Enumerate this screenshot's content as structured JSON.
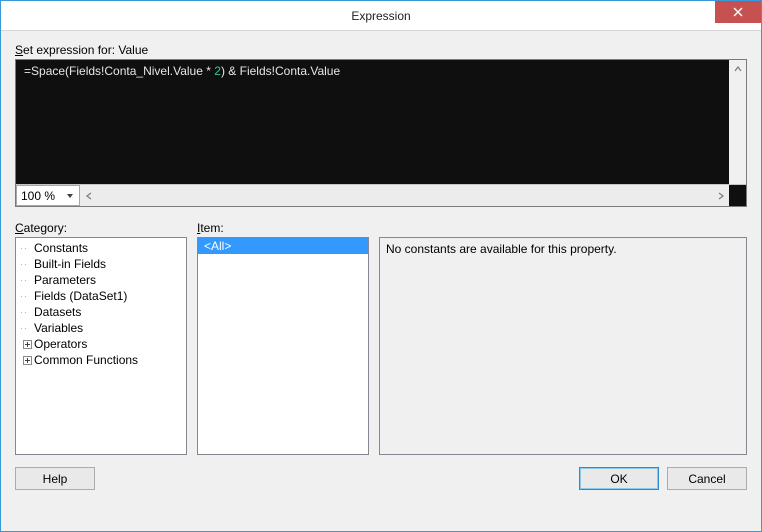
{
  "window": {
    "title": "Expression"
  },
  "labelExpressionPrefix": "S",
  "labelExpressionRest": "et expression for: Value",
  "code": {
    "t1": "=",
    "t2": "Space",
    "t3": "(Fields!Conta_Nivel.Value ",
    "t4": "*",
    "t5": " ",
    "t6": "2",
    "t7": ")",
    "t8": " ",
    "t9": "&",
    "t10": " Fields!Conta.Value"
  },
  "zoom": {
    "value": "100 %"
  },
  "category": {
    "labelU": "C",
    "labelRest": "ategory:",
    "items": [
      {
        "label": "Constants",
        "exp": ""
      },
      {
        "label": "Built-in Fields",
        "exp": ""
      },
      {
        "label": "Parameters",
        "exp": ""
      },
      {
        "label": "Fields (DataSet1)",
        "exp": ""
      },
      {
        "label": "Datasets",
        "exp": ""
      },
      {
        "label": "Variables",
        "exp": ""
      },
      {
        "label": "Operators",
        "exp": "+"
      },
      {
        "label": "Common Functions",
        "exp": "+"
      }
    ]
  },
  "item": {
    "labelU": "I",
    "labelRest": "tem:",
    "items": [
      {
        "label": "<All>",
        "selected": true
      }
    ]
  },
  "description": {
    "text": "No constants are available for this property."
  },
  "buttons": {
    "help": "Help",
    "ok": "OK",
    "cancel": "Cancel"
  }
}
